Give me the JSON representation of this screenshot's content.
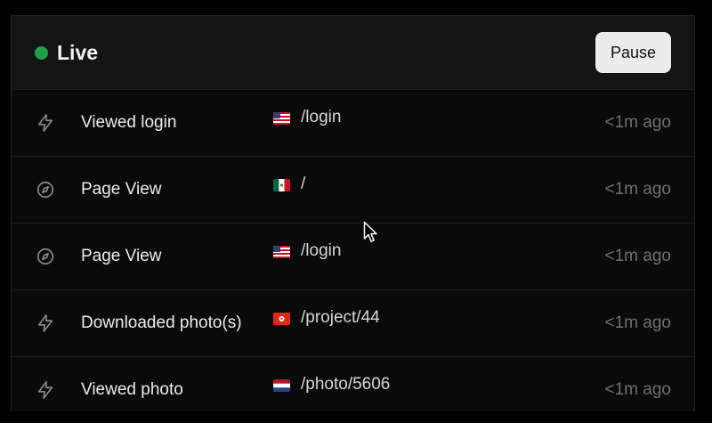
{
  "header": {
    "status_label": "Live",
    "status_color": "#1f9e4a",
    "pause_label": "Pause"
  },
  "rows": [
    {
      "icon": "bolt-icon",
      "event": "Viewed login",
      "flag": "US",
      "path": "/login",
      "time": "<1m ago"
    },
    {
      "icon": "compass-icon",
      "event": "Page View",
      "flag": "MX",
      "path": "/",
      "time": "<1m ago"
    },
    {
      "icon": "compass-icon",
      "event": "Page View",
      "flag": "US",
      "path": "/login",
      "time": "<1m ago"
    },
    {
      "icon": "bolt-icon",
      "event": "Downloaded photo(s)",
      "flag": "HK",
      "path": "/project/44",
      "time": "<1m ago"
    },
    {
      "icon": "bolt-icon",
      "event": "Viewed photo",
      "flag": "NL",
      "path": "/photo/5606",
      "time": "<1m ago"
    }
  ]
}
